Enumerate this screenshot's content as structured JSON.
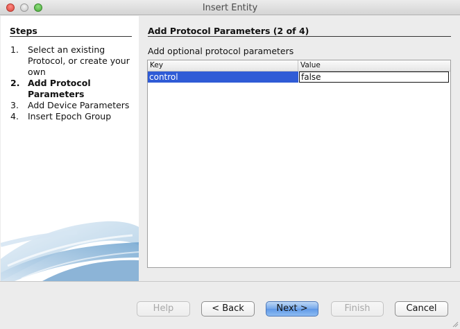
{
  "window": {
    "title": "Insert Entity"
  },
  "steps": {
    "heading": "Steps",
    "items": [
      {
        "num": "1.",
        "label": "Select an existing Protocol, or create your own"
      },
      {
        "num": "2.",
        "label": "Add Protocol Parameters"
      },
      {
        "num": "3.",
        "label": "Add Device Parameters"
      },
      {
        "num": "4.",
        "label": "Insert Epoch Group"
      }
    ],
    "current_index": 1
  },
  "content": {
    "heading": "Add Protocol Parameters (2 of 4)",
    "description": "Add optional protocol parameters",
    "table": {
      "columns": [
        "Key",
        "Value"
      ],
      "rows": [
        {
          "key": "control",
          "value": "false"
        }
      ]
    }
  },
  "buttons": {
    "help": "Help",
    "back": "< Back",
    "next": "Next >",
    "finish": "Finish",
    "cancel": "Cancel"
  },
  "colors": {
    "selection": "#2f5bd6",
    "default_button": "#74a7ea"
  }
}
